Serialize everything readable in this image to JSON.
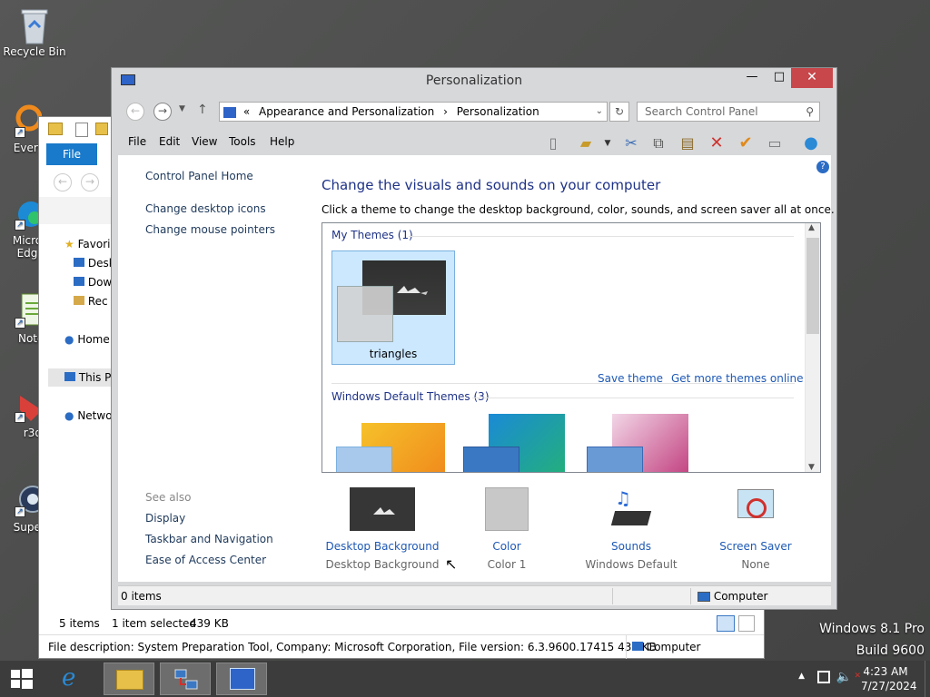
{
  "desktop": {
    "icons": [
      {
        "label": "Recycle Bin",
        "icon": "recycle-bin-icon"
      },
      {
        "label": "Everyth",
        "icon": "everything-icon"
      },
      {
        "label": "Micro Edg",
        "icon": "edge-icon"
      },
      {
        "label": "Notep",
        "icon": "notepad-icon"
      },
      {
        "label": "r3df",
        "icon": "r3df-icon"
      },
      {
        "label": "Superm",
        "icon": "supermium-icon"
      }
    ],
    "watermark_line1": "Windows 8.1 Pro",
    "watermark_line2": "Build 9600"
  },
  "explorer_bg": {
    "file_tab": "File",
    "nav": [
      "Favori",
      "Desk",
      "Dow",
      "Rec",
      "Home",
      "This P",
      "Netwo"
    ],
    "status_items": "5 items",
    "status_selected": "1 item selected",
    "status_size": "439 KB",
    "description": "File description: System Preparation Tool, Company: Microsoft Corporation, File version: 6.3.9600.17415 439 KB",
    "computer_label": "Computer"
  },
  "window": {
    "title": "Personalization",
    "minimize": "—",
    "maximize": "□",
    "close": "✕"
  },
  "address": {
    "chevron": "«",
    "crumb1": "Appearance and Personalization",
    "crumb_sep": "›",
    "crumb2": "Personalization",
    "search_placeholder": "Search Control Panel"
  },
  "menu": {
    "file": "File",
    "edit": "Edit",
    "view": "View",
    "tools": "Tools",
    "help": "Help"
  },
  "sidebar": {
    "home": "Control Panel Home",
    "link1": "Change desktop icons",
    "link2": "Change mouse pointers",
    "see_also": "See also",
    "see1": "Display",
    "see2": "Taskbar and Navigation",
    "see3": "Ease of Access Center"
  },
  "main": {
    "title": "Change the visuals and sounds on your computer",
    "subtitle": "Click a theme to change the desktop background, color, sounds, and screen saver all at once.",
    "my_themes": "My Themes (1)",
    "theme_name": "triangles",
    "save_theme": "Save theme",
    "get_more": "Get more themes online",
    "default_themes": "Windows Default Themes (3)"
  },
  "bottom": [
    {
      "label": "Desktop Background",
      "value": "Desktop Background"
    },
    {
      "label": "Color",
      "value": "Color 1"
    },
    {
      "label": "Sounds",
      "value": "Windows Default"
    },
    {
      "label": "Screen Saver",
      "value": "None"
    }
  ],
  "status": {
    "items": "0 items",
    "computer": "Computer"
  },
  "tray": {
    "time": "4:23 AM",
    "date": "7/27/2024"
  }
}
